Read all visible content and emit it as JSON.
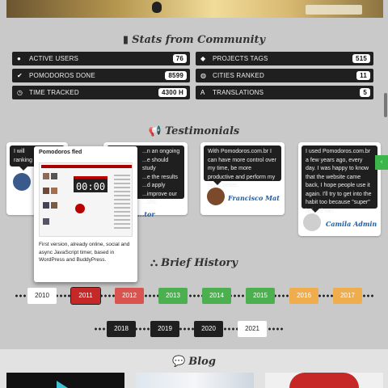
{
  "stats_section": {
    "title": "Stats from Community",
    "items": [
      {
        "icon": "user-icon",
        "label": "Active Users",
        "value": "76"
      },
      {
        "icon": "tags-icon",
        "label": "Projects Tags",
        "value": "515"
      },
      {
        "icon": "check-icon",
        "label": "Pomodoros Done",
        "value": "8599"
      },
      {
        "icon": "globe-icon",
        "label": "Cities Ranked",
        "value": "11"
      },
      {
        "icon": "clock-icon",
        "label": "Time Tracked",
        "value": "4300 H"
      },
      {
        "icon": "translate-icon",
        "label": "Translations",
        "value": "5"
      }
    ]
  },
  "testimonials_section": {
    "title": "Testimonials",
    "items": [
      {
        "text": "I will \nranking",
        "author": ""
      },
      {
        "text": "...n an ongoing\n...e should study\n...e the results\n...d apply\n...improve our\n...ults.",
        "author": "...tor"
      },
      {
        "text": "With Pomodoros.com.br I can have more control over my time, be more productive and perform my tasks better.",
        "author": "Francisco Mat"
      },
      {
        "text": "I used Pomodoros.com.br a few years ago, every day. I was happy to know that the website came back, I hope people use it again. I'll try to get into the habit too because \"super\" helped me!",
        "author": "Camila Admin"
      }
    ]
  },
  "tooltip": {
    "title": "Pomodoros fled",
    "clock": "00:00",
    "description": "First version, already online, social and async JavaScript timer, based in WordPress and BuddyPress."
  },
  "history_section": {
    "title": "Brief History",
    "row1": [
      {
        "year": "2010",
        "color": "#ffffff",
        "text_color": "#222222"
      },
      {
        "year": "2011",
        "color": "#c62828",
        "text_color": "#ffffff"
      },
      {
        "year": "2012",
        "color": "#d9534f",
        "text_color": "#ffffff"
      },
      {
        "year": "2013",
        "color": "#4caf50",
        "text_color": "#ffffff"
      },
      {
        "year": "2014",
        "color": "#4caf50",
        "text_color": "#ffffff"
      },
      {
        "year": "2015",
        "color": "#4caf50",
        "text_color": "#ffffff"
      },
      {
        "year": "2016",
        "color": "#f0ad4e",
        "text_color": "#ffffff"
      },
      {
        "year": "2017",
        "color": "#f0ad4e",
        "text_color": "#ffffff"
      }
    ],
    "row2": [
      {
        "year": "2018",
        "color": "#1f1f1f",
        "text_color": "#ffffff"
      },
      {
        "year": "2019",
        "color": "#1f1f1f",
        "text_color": "#ffffff"
      },
      {
        "year": "2020",
        "color": "#1f1f1f",
        "text_color": "#ffffff"
      },
      {
        "year": "2021",
        "color": "#ffffff",
        "text_color": "#222222"
      }
    ]
  },
  "blog_section": {
    "title": "Blog"
  },
  "fab": {
    "label": "‹"
  }
}
